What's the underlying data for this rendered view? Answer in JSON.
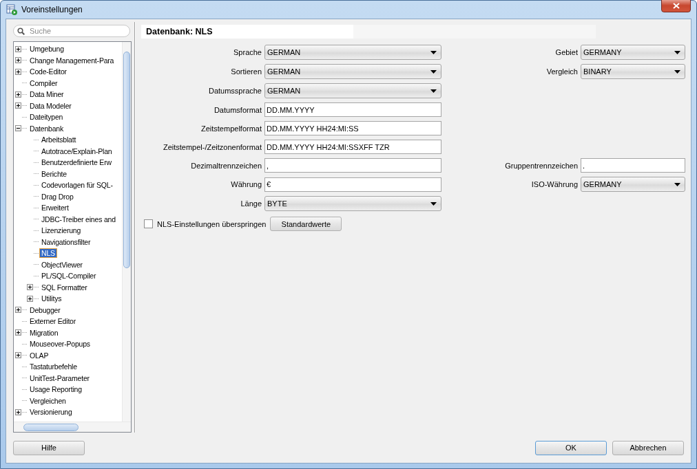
{
  "window": {
    "title": "Voreinstellungen"
  },
  "search": {
    "placeholder": "Suche"
  },
  "tree": [
    {
      "label": "Umgebung",
      "expanded": false,
      "selected": false
    },
    {
      "label": "Change Management-Para",
      "expanded": false,
      "selected": false
    },
    {
      "label": "Code-Editor",
      "expanded": false,
      "selected": false
    },
    {
      "label": "Compiler",
      "selected": false
    },
    {
      "label": "Data Miner",
      "expanded": false,
      "selected": false
    },
    {
      "label": "Data Modeler",
      "expanded": false,
      "selected": false
    },
    {
      "label": "Dateitypen",
      "selected": false
    },
    {
      "label": "Datenbank",
      "expanded": true,
      "selected": false,
      "children": [
        {
          "label": "Arbeitsblatt",
          "selected": false
        },
        {
          "label": "Autotrace/Explain-Plan",
          "selected": false
        },
        {
          "label": "Benutzerdefinierte Erw",
          "selected": false
        },
        {
          "label": "Berichte",
          "selected": false
        },
        {
          "label": "Codevorlagen für SQL-",
          "selected": false
        },
        {
          "label": "Drag  Drop",
          "selected": false
        },
        {
          "label": "Erweitert",
          "selected": false
        },
        {
          "label": "JDBC-Treiber eines and",
          "selected": false
        },
        {
          "label": "Lizenzierung",
          "selected": false
        },
        {
          "label": "Navigationsfilter",
          "selected": false
        },
        {
          "label": "NLS",
          "selected": true
        },
        {
          "label": "ObjectViewer",
          "selected": false
        },
        {
          "label": "PL/SQL-Compiler",
          "selected": false
        },
        {
          "label": "SQL Formatter",
          "expanded": false,
          "selected": false
        },
        {
          "label": "Utilitys",
          "expanded": false,
          "selected": false
        }
      ]
    },
    {
      "label": "Debugger",
      "expanded": false,
      "selected": false
    },
    {
      "label": "Externer Editor",
      "selected": false
    },
    {
      "label": "Migration",
      "expanded": false,
      "selected": false
    },
    {
      "label": "Mouseover-Popups",
      "selected": false
    },
    {
      "label": "OLAP",
      "expanded": false,
      "selected": false
    },
    {
      "label": "Tastaturbefehle",
      "selected": false
    },
    {
      "label": "UnitTest-Parameter",
      "selected": false
    },
    {
      "label": "Usage Reporting",
      "selected": false
    },
    {
      "label": "Vergleichen",
      "selected": false
    },
    {
      "label": "Versionierung",
      "expanded": false,
      "selected": false
    }
  ],
  "panel": {
    "title": "Datenbank: NLS",
    "rows": [
      {
        "left": {
          "label": "Sprache",
          "kind": "dropdown",
          "value": "GERMAN"
        },
        "right": {
          "label": "Gebiet",
          "kind": "dropdown",
          "value": "GERMANY"
        }
      },
      {
        "left": {
          "label": "Sortieren",
          "kind": "dropdown",
          "value": "GERMAN"
        },
        "right": {
          "label": "Vergleich",
          "kind": "dropdown",
          "value": "BINARY"
        }
      },
      {
        "left": {
          "label": "Datumssprache",
          "kind": "dropdown",
          "value": "GERMAN"
        }
      },
      {
        "left": {
          "label": "Datumsformat",
          "kind": "text",
          "value": "DD.MM.YYYY"
        }
      },
      {
        "left": {
          "label": "Zeitstempelformat",
          "kind": "text",
          "value": "DD.MM.YYYY HH24:MI:SS"
        }
      },
      {
        "left": {
          "label": "Zeitstempel-/Zeitzonenformat",
          "kind": "text",
          "value": "DD.MM.YYYY HH24:MI:SSXFF TZR"
        }
      },
      {
        "left": {
          "label": "Dezimaltrennzeichen",
          "kind": "text",
          "value": ","
        },
        "right": {
          "label": "Gruppentrennzeichen",
          "kind": "text",
          "value": "."
        }
      },
      {
        "left": {
          "label": "Währung",
          "kind": "text",
          "value": "€"
        },
        "right": {
          "label": "ISO-Währung",
          "kind": "dropdown",
          "value": "GERMANY"
        }
      },
      {
        "left": {
          "label": "Länge",
          "kind": "dropdown",
          "value": "BYTE"
        }
      }
    ],
    "skip": {
      "label": "NLS-Einstellungen überspringen",
      "checked": false
    },
    "defaults_button": "Standardwerte"
  },
  "buttons": {
    "help": "Hilfe",
    "ok": "OK",
    "cancel": "Abbrechen"
  }
}
